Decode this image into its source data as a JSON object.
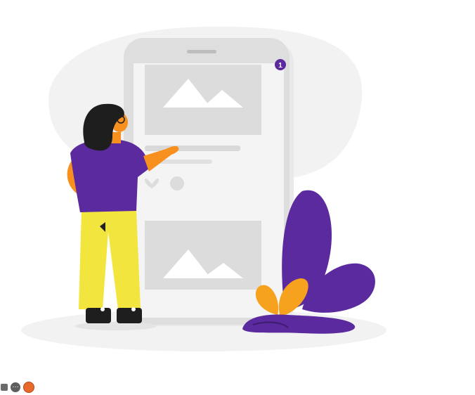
{
  "illustration": {
    "phone_badge": "1"
  },
  "colors": {
    "purple": "#5b2a9e",
    "yellow": "#f2e53d",
    "orange": "#f7901e",
    "phone_gray": "#dedede",
    "phone_light": "#f4f4f4",
    "blob_gray": "#f2f2f2"
  },
  "taskbar": {
    "icons": [
      "video-icon",
      "more-icon",
      "user-avatar-icon"
    ]
  }
}
